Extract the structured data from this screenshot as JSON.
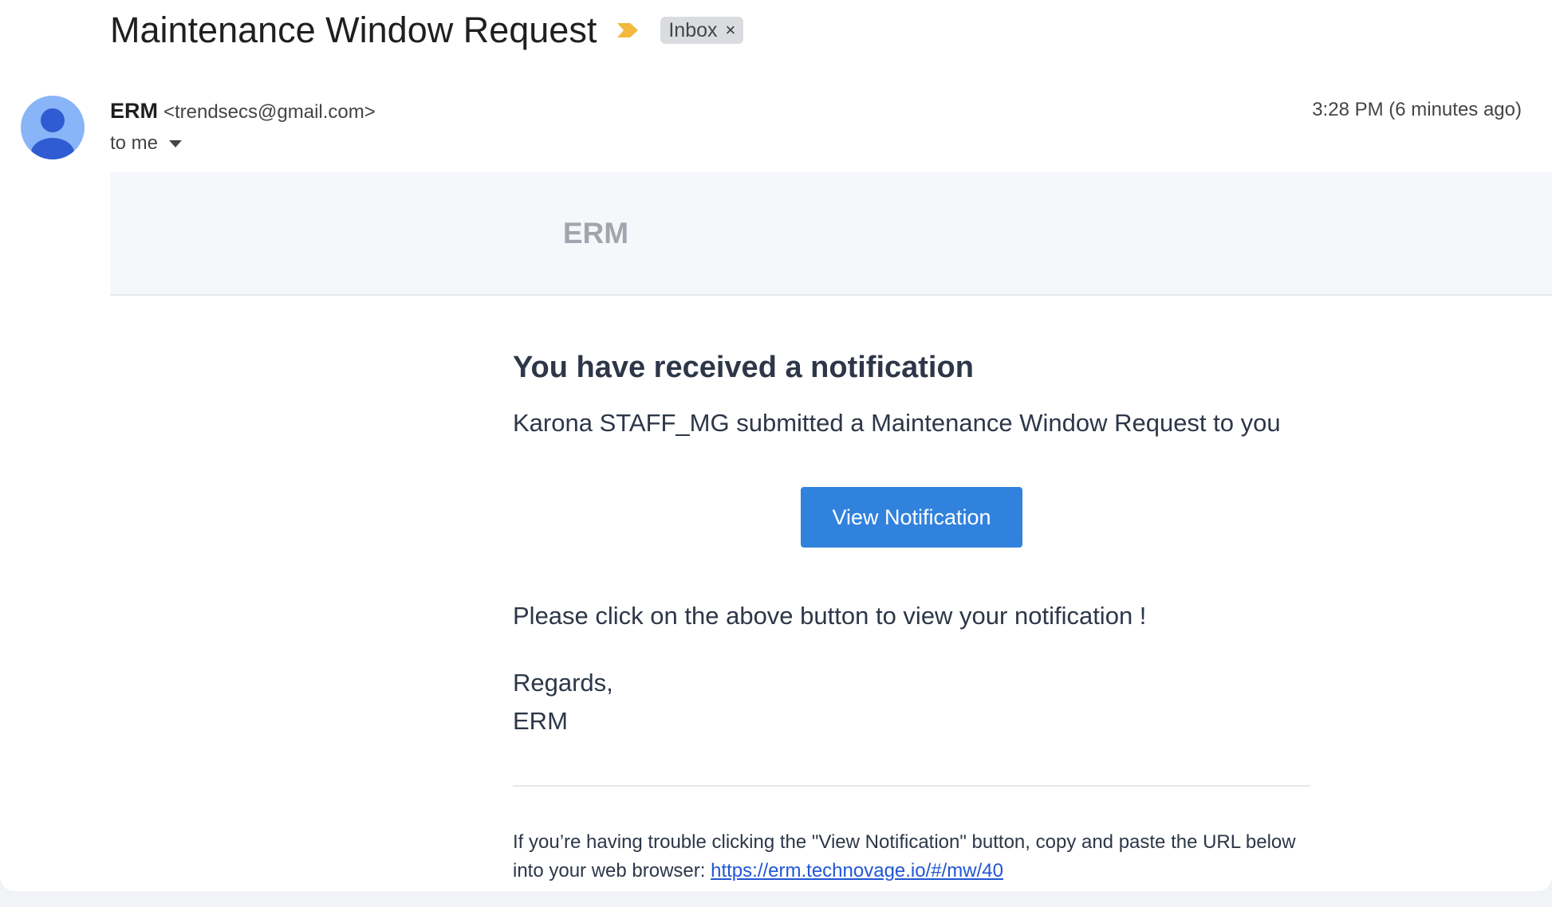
{
  "subject": "Maintenance Window Request",
  "label": {
    "text": "Inbox",
    "remove_glyph": "×"
  },
  "icons": {
    "important": "important-marker-icon",
    "avatar": "person-avatar-icon",
    "recipient_caret": "caret-down-icon",
    "label_close": "close-icon"
  },
  "colors": {
    "important": "#f2b83b",
    "button": "#3182dd",
    "link": "#2156d3",
    "avatar_bg": "#8ab4f8",
    "avatar_fg": "#2f5bd3"
  },
  "sender": {
    "name": "ERM",
    "email": "<trendsecs@gmail.com>"
  },
  "recipient": "to me",
  "timestamp": "3:28 PM (6 minutes ago)",
  "email": {
    "brand": "ERM",
    "heading": "You have received a notification",
    "intro": "Karona STAFF_MG submitted a Maintenance Window Request to you",
    "button_label": "View Notification",
    "instruction": "Please click on the above button to view your notification !",
    "regards": "Regards,",
    "signature": "ERM",
    "trouble_text": "If you’re having trouble clicking the \"View Notification\" button, copy and paste the URL below into your web browser:",
    "url": "https://erm.technovage.io/#/mw/40"
  }
}
